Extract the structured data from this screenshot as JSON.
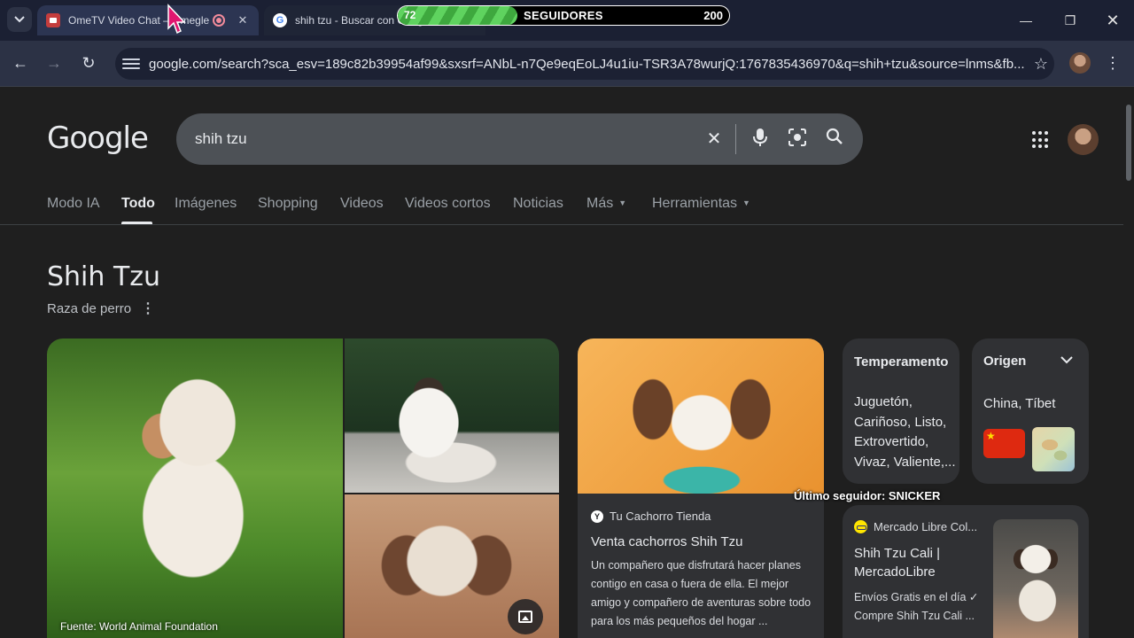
{
  "browser": {
    "tabs": [
      {
        "title": "OmeTV Video Chat – Omegle",
        "active": true
      },
      {
        "title": "shih tzu - Buscar con Google",
        "active": false
      }
    ],
    "url": "google.com/search?sca_esv=189c82b39954af99&sxsrf=ANbL-n7Qe9eqEoLJ4u1iu-TSR3A78wurjQ:1767835436970&q=shih+tzu&source=lnms&fb..."
  },
  "overlay": {
    "followers_current": "72",
    "followers_label": "SEGUIDORES",
    "followers_goal": "200",
    "followers_progress": 0.36,
    "last_follower": "Último seguidor: SNICKER"
  },
  "search": {
    "logo": "Google",
    "query": "shih tzu"
  },
  "nav_tabs": [
    {
      "label": "Modo IA"
    },
    {
      "label": "Todo"
    },
    {
      "label": "Imágenes"
    },
    {
      "label": "Shopping"
    },
    {
      "label": "Videos"
    },
    {
      "label": "Videos cortos"
    },
    {
      "label": "Noticias"
    },
    {
      "label": "Más"
    },
    {
      "label": "Herramientas"
    }
  ],
  "knowledge_panel": {
    "title": "Shih Tzu",
    "subtitle": "Raza de perro",
    "image_source": "Fuente: World Animal Foundation"
  },
  "store_card": {
    "source": "Tu Cachorro Tienda",
    "title": "Venta cachorros Shih Tzu",
    "description": "Un compañero que disfrutará hacer planes contigo en casa o fuera de ella. El mejor amigo y compañero de aventuras sobre todo para los más pequeños del hogar ..."
  },
  "temperament_card": {
    "title": "Temperamento",
    "text": "Juguetón, Cariñoso, Listo, Extrovertido, Vivaz, Valiente,..."
  },
  "origin_card": {
    "title": "Origen",
    "text": "China, Tíbet"
  },
  "ml_card": {
    "source": "Mercado Libre Col...",
    "title": "Shih Tzu Cali | MercadoLibre",
    "description": "Envíos Gratis en el día ✓ Compre Shih Tzu Cali ..."
  }
}
